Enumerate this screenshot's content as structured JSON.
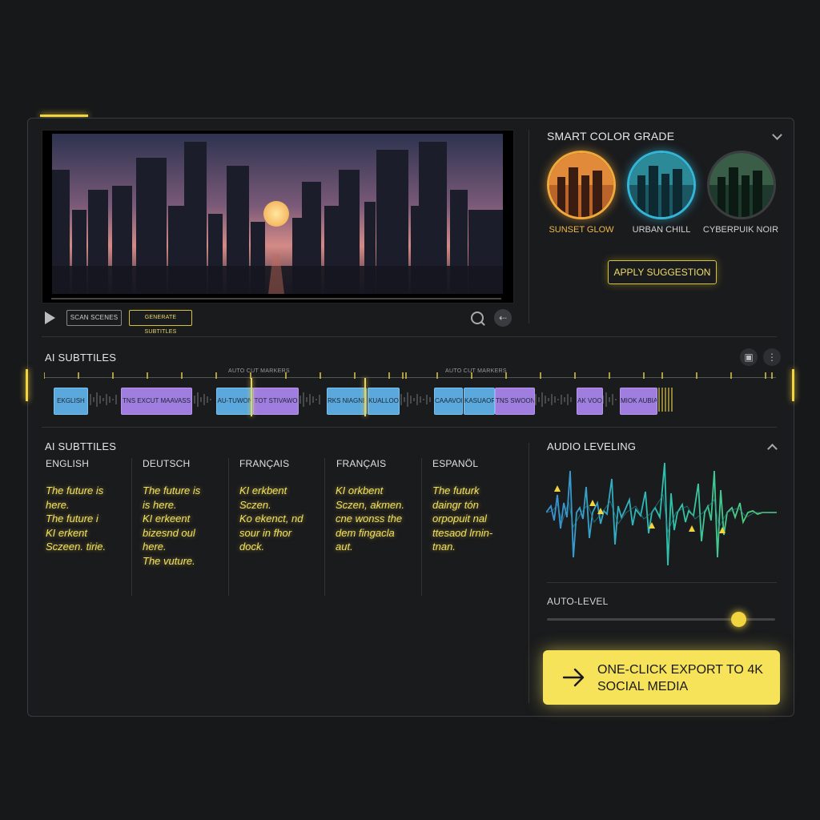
{
  "preview": {
    "scan_label": "SCAN SCENES",
    "generate_label": "GENERATE SUBTITLES"
  },
  "color_grade": {
    "title": "SMART COLOR GRADE",
    "presets": [
      {
        "label": "SUNSET GLOW",
        "ring": "#f0a93a"
      },
      {
        "label": "URBAN CHILL",
        "ring": "#34b6d8"
      },
      {
        "label": "CYBERPUIK NOIR",
        "ring": "#3c3d40"
      }
    ],
    "apply_label": "APPLY SUGGESTION"
  },
  "timeline": {
    "title": "AI SUBTTILES",
    "marker_labels": [
      "AUTO CUT MARKERS",
      "AUTO CUT MARKERS"
    ],
    "clips": [
      "EKGLISH",
      "TNS EXCUT MAAVASS",
      "AU-TUWON",
      "TOT STIVAWO",
      "RKS NIAGNE",
      "KUALLOO",
      "CAAAVON",
      "KASUAOR",
      "TNS SWOON",
      "AK VOO",
      "MIOK AUBIA"
    ]
  },
  "subtitles": {
    "title": "AI SUBTTILES",
    "columns": [
      {
        "lang": "ENGLISH",
        "text": "The future is\nhere.\nThe future i\nKI erkent\nSczeen. tirie."
      },
      {
        "lang": "DEUTSCH",
        "text": "The future is\nis here.\nKI erkeent\nbizesnd oul\nhere.\nThe vuture."
      },
      {
        "lang": "FRANÇAIS",
        "text": "KI erkbent\nSczen.\nKo ekenct, nd\nsour in fhor\ndock."
      },
      {
        "lang": "FRANÇAIS",
        "text": "KI orkbent\nSczen, akmen.\ncne wonss the\ndem fingacla\naut."
      },
      {
        "lang": "ESPANÖL",
        "text": "The futurk\ndaingr tón\norpopuit nal\nttesaod lrnin-\ntnan."
      }
    ]
  },
  "audio": {
    "title": "AUDIO LEVELING",
    "auto_level_label": "AUTO-LEVEL",
    "auto_level_value": 0.84
  },
  "export": {
    "label": "ONE-CLICK EXPORT TO 4K SOCIAL MEDIA"
  },
  "accent": "#f2d440"
}
